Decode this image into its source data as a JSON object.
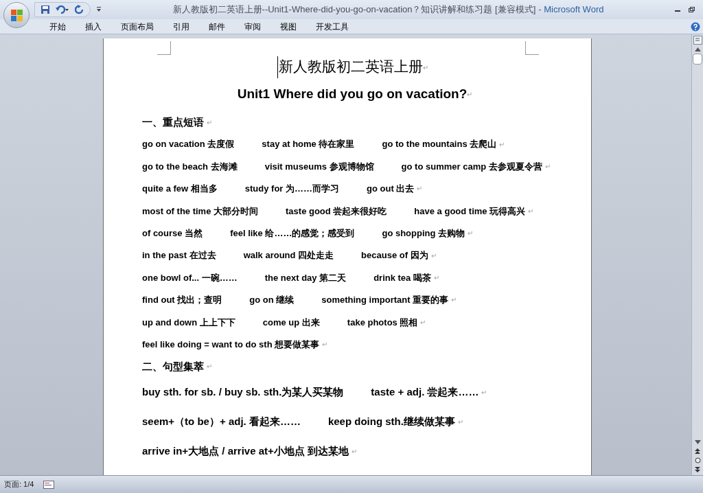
{
  "window": {
    "title": "新人教版初二英语上册--Unit1-Where-did-you-go-on-vacation？知识讲解和练习题 [兼容模式]",
    "app": "- Microsoft Word"
  },
  "ribbon_tabs": [
    {
      "label": "开始",
      "selected": false
    },
    {
      "label": "插入",
      "selected": false
    },
    {
      "label": "页面布局",
      "selected": false
    },
    {
      "label": "引用",
      "selected": false
    },
    {
      "label": "邮件",
      "selected": false
    },
    {
      "label": "审阅",
      "selected": false
    },
    {
      "label": "视图",
      "selected": false
    },
    {
      "label": "开发工具",
      "selected": false
    }
  ],
  "document": {
    "title": "新人教版初二英语上册",
    "subtitle": "Unit1 Where did you go on vacation?",
    "blocks": [
      {
        "kind": "heading",
        "segments": [
          "一、重点短语"
        ]
      },
      {
        "kind": "phrase",
        "segments": [
          "go on vacation 去度假",
          "stay at home 待在家里",
          "go to the mountains 去爬山"
        ]
      },
      {
        "kind": "phrase",
        "segments": [
          "go to the beach 去海滩",
          "visit museums 参观博物馆",
          "go to summer camp 去参观夏令营"
        ]
      },
      {
        "kind": "phrase",
        "segments": [
          "quite a few 相当多",
          "study for 为……而学习",
          "go out 出去"
        ]
      },
      {
        "kind": "phrase",
        "segments": [
          "most of the time 大部分时间",
          "taste good 尝起来很好吃",
          "have a good time 玩得高兴"
        ]
      },
      {
        "kind": "phrase",
        "segments": [
          "of course 当然",
          "feel like 给……的感觉；感受到",
          "go shopping 去购物"
        ]
      },
      {
        "kind": "phrase",
        "segments": [
          "in the past 在过去",
          "walk around 四处走走",
          "because of 因为"
        ]
      },
      {
        "kind": "phrase",
        "segments": [
          "one bowl of... 一碗……",
          "the next day 第二天",
          "drink tea 喝茶"
        ]
      },
      {
        "kind": "phrase",
        "segments": [
          "find out 找出；查明",
          "go on 继续",
          "something important 重要的事"
        ]
      },
      {
        "kind": "phrase",
        "segments": [
          "up and down 上上下下",
          "come up 出来",
          "take photos 照相"
        ]
      },
      {
        "kind": "phrase",
        "segments": [
          "feel like doing = want to do sth 想要做某事"
        ]
      },
      {
        "kind": "heading",
        "segments": [
          "二、句型集萃"
        ]
      },
      {
        "kind": "sentence",
        "segments": [
          "buy sth. for sb. / buy sb. sth.为某人买某物",
          "taste + adj. 尝起来……"
        ]
      },
      {
        "kind": "sentence",
        "segments": [
          "seem+（to be）+ adj.  看起来……",
          "keep doing sth.继续做某事"
        ]
      },
      {
        "kind": "sentence",
        "segments": [
          "arrive in+大地点 / arrive at+小地点   到达某地"
        ]
      }
    ],
    "paragraph_mark": "↵"
  },
  "status_bar": {
    "page": "页面: 1/4"
  }
}
